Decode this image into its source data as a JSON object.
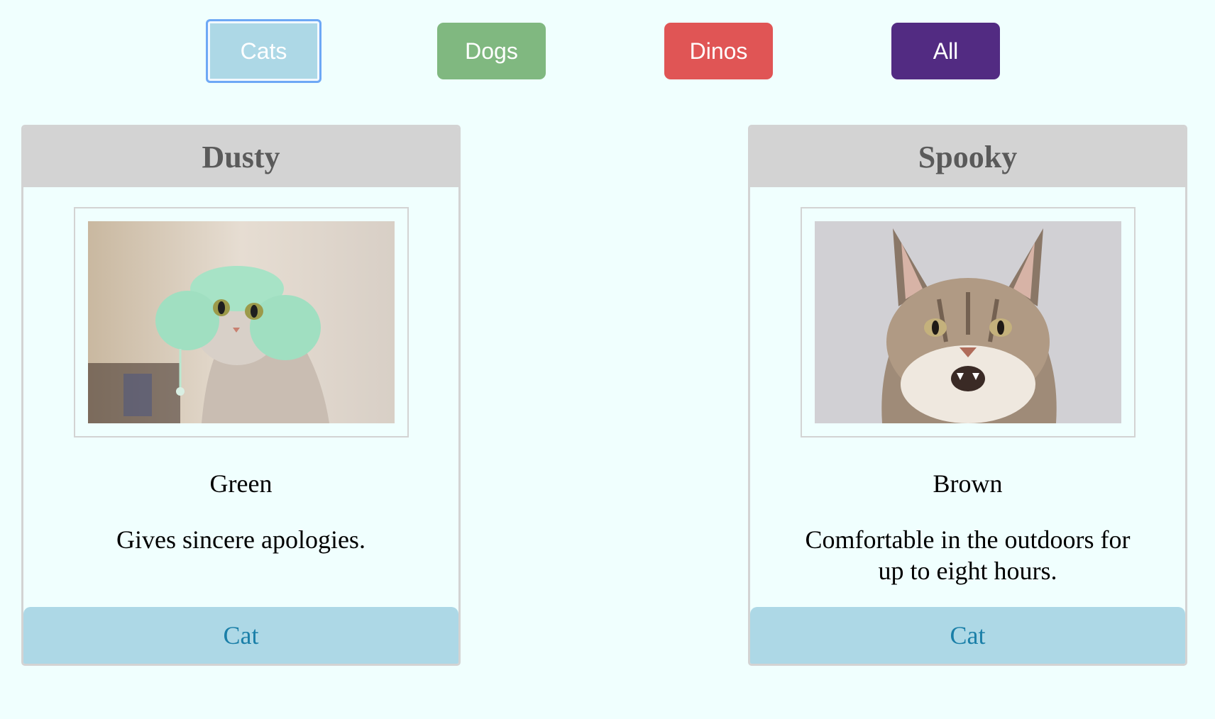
{
  "filters": {
    "cats_label": "Cats",
    "dogs_label": "Dogs",
    "dinos_label": "Dinos",
    "all_label": "All"
  },
  "cards": [
    {
      "name": "Dusty",
      "color": "Green",
      "description": "Gives sincere apologies.",
      "type": "Cat"
    },
    {
      "name": "Spooky",
      "color": "Brown",
      "description": "Comfortable in the outdoors for up to eight hours.",
      "type": "Cat"
    }
  ],
  "colors": {
    "background": "#f0fffe",
    "cats_button": "#add8e6",
    "dogs_button": "#80b880",
    "dinos_button": "#e05555",
    "all_button": "#522b82",
    "card_header": "#d3d3d3",
    "card_footer": "#add8e6",
    "footer_text": "#1a7fa8"
  }
}
